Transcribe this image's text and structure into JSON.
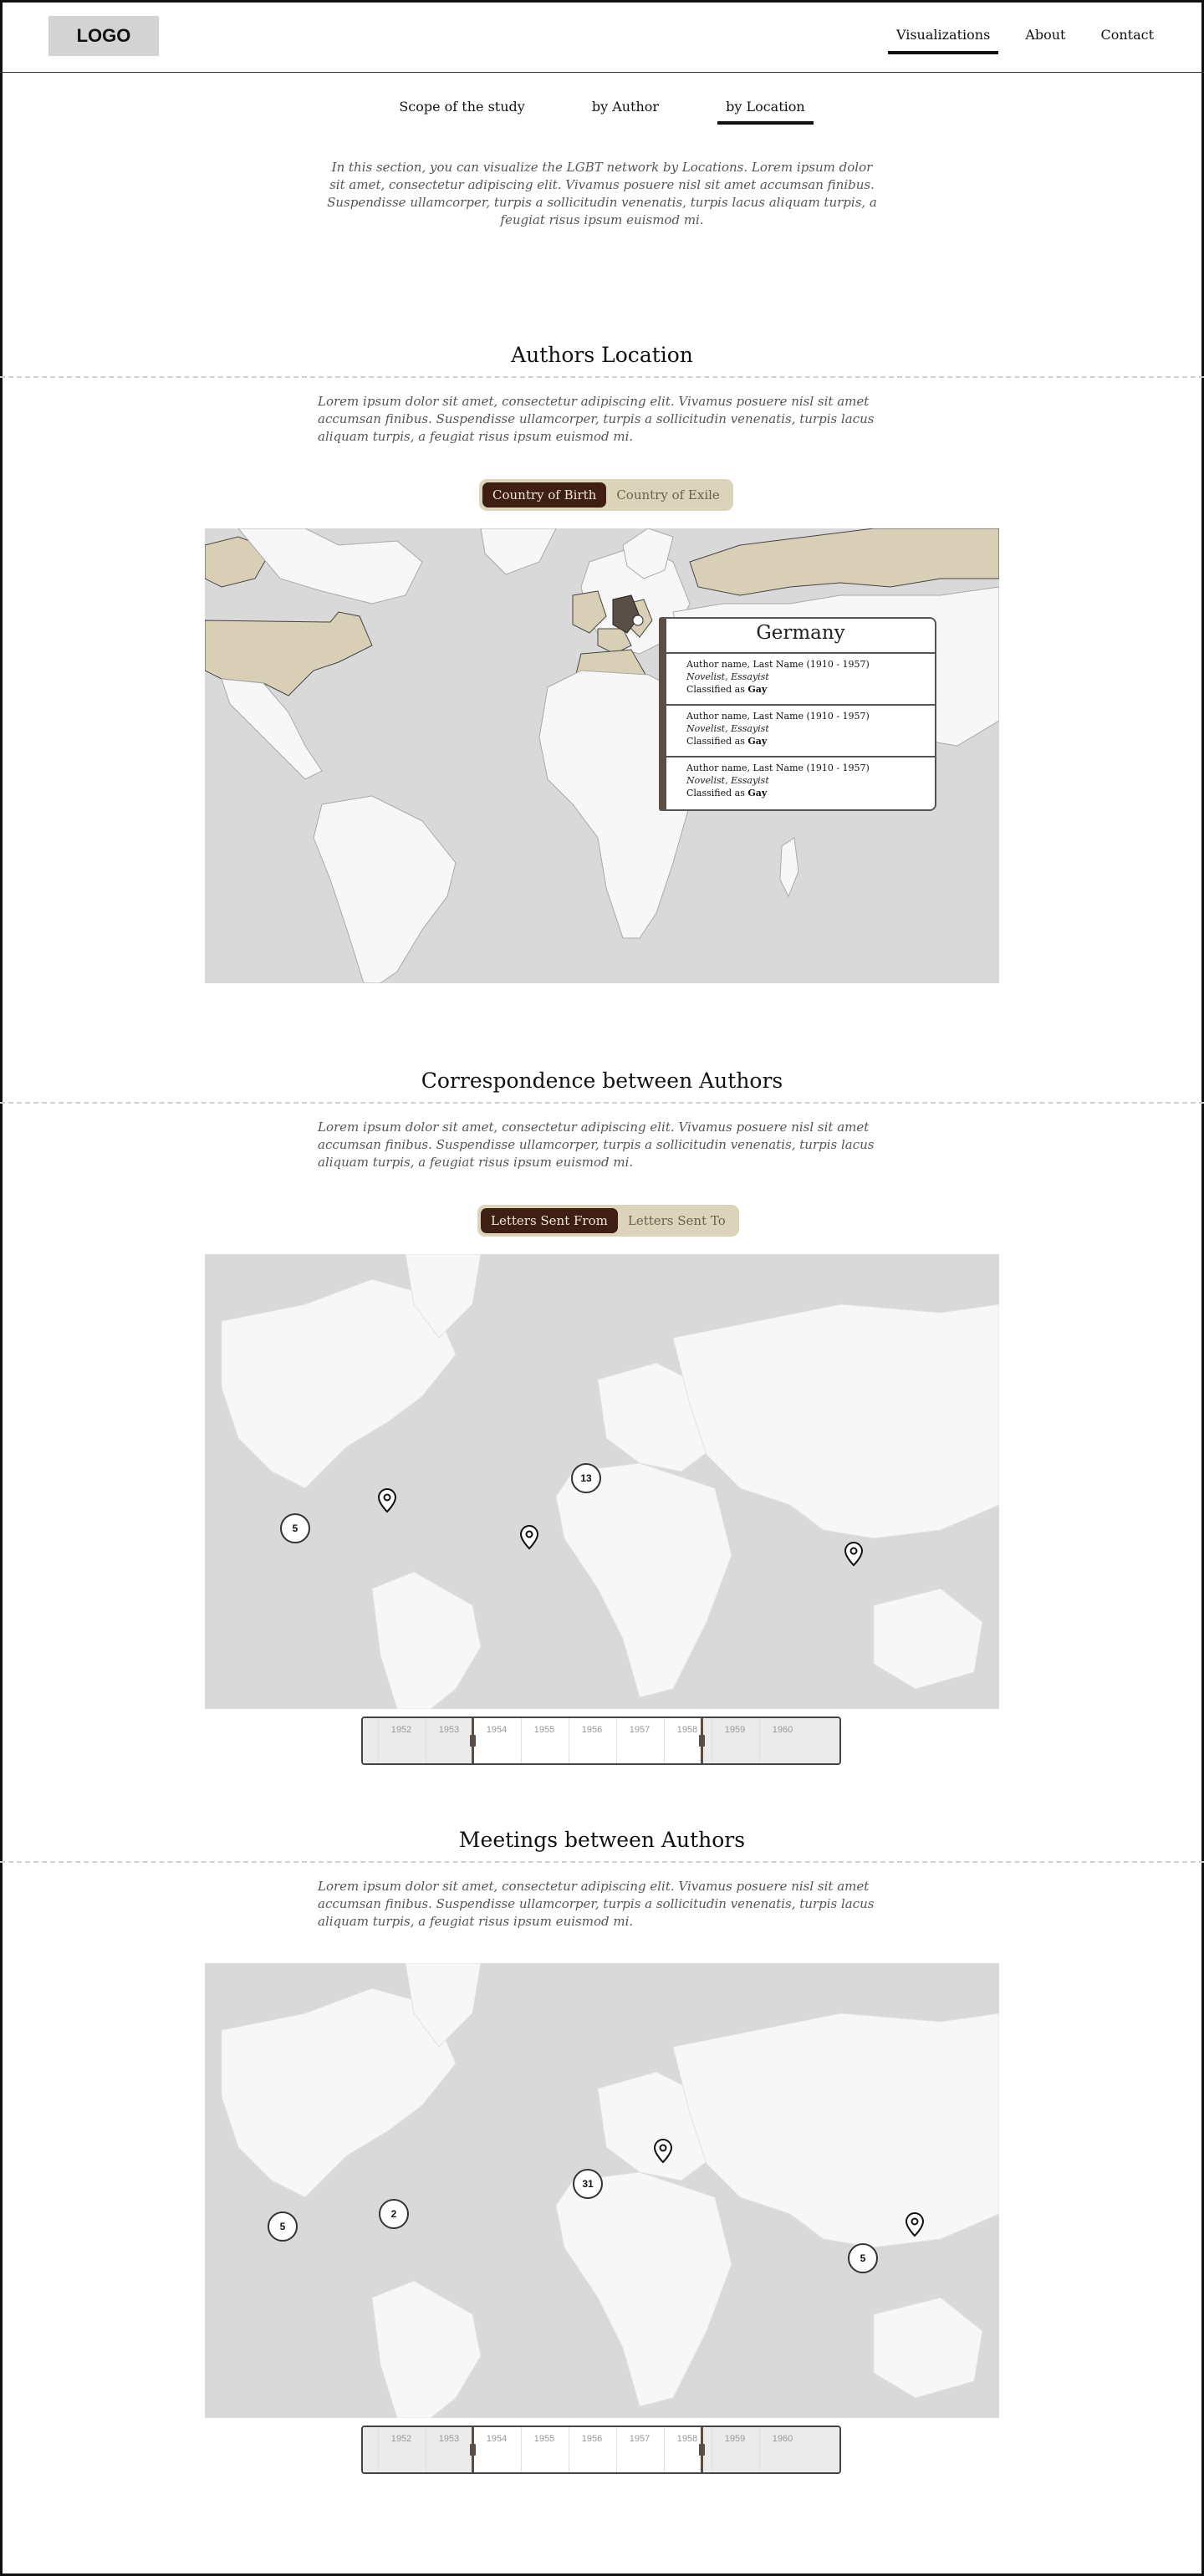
{
  "header": {
    "logo": "LOGO",
    "nav": [
      {
        "label": "Visualizations",
        "active": true
      },
      {
        "label": "About",
        "active": false
      },
      {
        "label": "Contact",
        "active": false
      }
    ]
  },
  "subnav": [
    {
      "label": "Scope of the study",
      "active": false
    },
    {
      "label": "by Author",
      "active": false
    },
    {
      "label": "by Location",
      "active": true
    }
  ],
  "intro": "In this section, you can visualize the LGBT network by Locations. Lorem ipsum dolor sit amet, consectetur adipiscing elit. Vivamus posuere nisl sit amet accumsan finibus. Suspendisse ullamcorper, turpis a sollicitudin venenatis, turpis lacus aliquam turpis, a feugiat risus ipsum euismod mi.",
  "colors": {
    "accent_dark": "#3f1f14",
    "toggle_bg": "#dcd3bb",
    "highlight_land": "#d8cfb6",
    "map_ocean": "#d9d9d9",
    "map_land": "#f7f7f7"
  },
  "sections": {
    "location": {
      "title": "Authors Location",
      "text": "Lorem ipsum dolor sit amet, consectetur adipiscing elit. Vivamus posuere nisl sit amet accumsan finibus. Suspendisse ullamcorper, turpis a sollicitudin venenatis, turpis lacus aliquam turpis, a feugiat risus ipsum euismod mi.",
      "toggle": {
        "active": "Country of Birth",
        "inactive": "Country of Exile"
      },
      "popup": {
        "country": "Germany",
        "entries": [
          {
            "name": "Author name, Last Name (1910 - 1957)",
            "role": "Novelist, Essayist",
            "class_prefix": "Classified as ",
            "class": "Gay"
          },
          {
            "name": "Author name, Last Name (1910 - 1957)",
            "role": "Novelist, Essayist",
            "class_prefix": "Classified as ",
            "class": "Gay"
          },
          {
            "name": "Author name, Last Name (1910 - 1957)",
            "role": "Novelist, Essayist",
            "class_prefix": "Classified as ",
            "class": "Gay"
          }
        ]
      }
    },
    "correspondence": {
      "title": "Correspondence between Authors",
      "text": "Lorem ipsum dolor sit amet, consectetur adipiscing elit. Vivamus posuere nisl sit amet accumsan finibus. Suspendisse ullamcorper, turpis a sollicitudin venenatis, turpis lacus aliquam turpis, a feugiat risus ipsum euismod mi.",
      "toggle": {
        "active": "Letters Sent From",
        "inactive": "Letters Sent To"
      },
      "badges": [
        "5",
        "13"
      ],
      "timeline": {
        "years": [
          "1952",
          "1953",
          "1954",
          "1955",
          "1956",
          "1957",
          "1958",
          "1959",
          "1960"
        ],
        "range": [
          "1953",
          "1958"
        ]
      }
    },
    "meetings": {
      "title": "Meetings between Authors",
      "text": "Lorem ipsum dolor sit amet, consectetur adipiscing elit. Vivamus posuere nisl sit amet accumsan finibus. Suspendisse ullamcorper, turpis a sollicitudin venenatis, turpis lacus aliquam turpis, a feugiat risus ipsum euismod mi.",
      "badges": [
        "5",
        "2",
        "31",
        "5"
      ],
      "timeline": {
        "years": [
          "1952",
          "1953",
          "1954",
          "1955",
          "1956",
          "1957",
          "1958",
          "1959",
          "1960"
        ],
        "range": [
          "1953",
          "1958"
        ]
      }
    }
  }
}
